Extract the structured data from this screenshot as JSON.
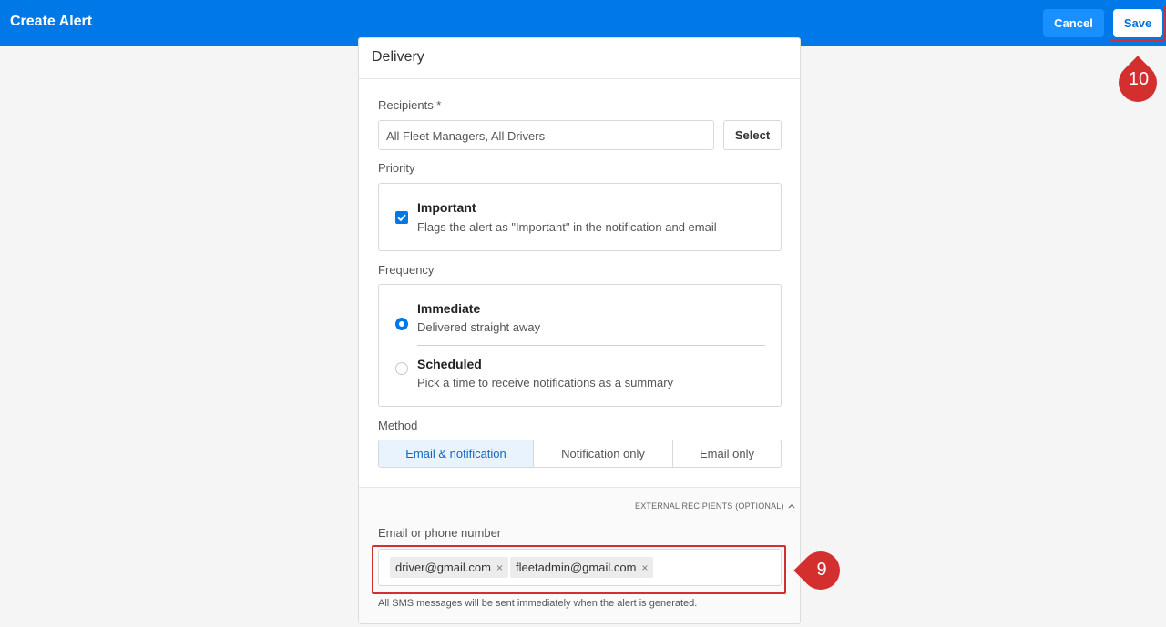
{
  "header": {
    "title": "Create Alert",
    "cancel_label": "Cancel",
    "save_label": "Save"
  },
  "annotations": {
    "step_save": "10",
    "step_recipients": "9"
  },
  "delivery": {
    "title": "Delivery",
    "recipients_label": "Recipients *",
    "recipients_value": "All Fleet Managers, All Drivers",
    "select_label": "Select",
    "priority_label": "Priority",
    "important_title": "Important",
    "important_desc": "Flags the alert as \"Important\" in the notification and email",
    "important_checked": true,
    "frequency_label": "Frequency",
    "frequency_options": [
      {
        "title": "Immediate",
        "desc": "Delivered straight away",
        "selected": true
      },
      {
        "title": "Scheduled",
        "desc": "Pick a time to receive notifications as a summary",
        "selected": false
      }
    ],
    "method_label": "Method",
    "methods": [
      "Email & notification",
      "Notification only",
      "Email only"
    ],
    "method_selected": "Email & notification"
  },
  "external": {
    "toggle_label": "EXTERNAL RECIPIENTS (OPTIONAL)",
    "field_label": "Email or phone number",
    "tags": [
      "driver@gmail.com",
      "fleetadmin@gmail.com"
    ],
    "note": "All SMS messages will be sent immediately when the alert is generated."
  },
  "colors": {
    "brand": "#0078e7",
    "annotation": "#d32f2f"
  },
  "icons": {
    "checkbox": "checkbox-checked-icon",
    "tag_remove": "close-icon",
    "chevron": "chevron-up-icon"
  }
}
